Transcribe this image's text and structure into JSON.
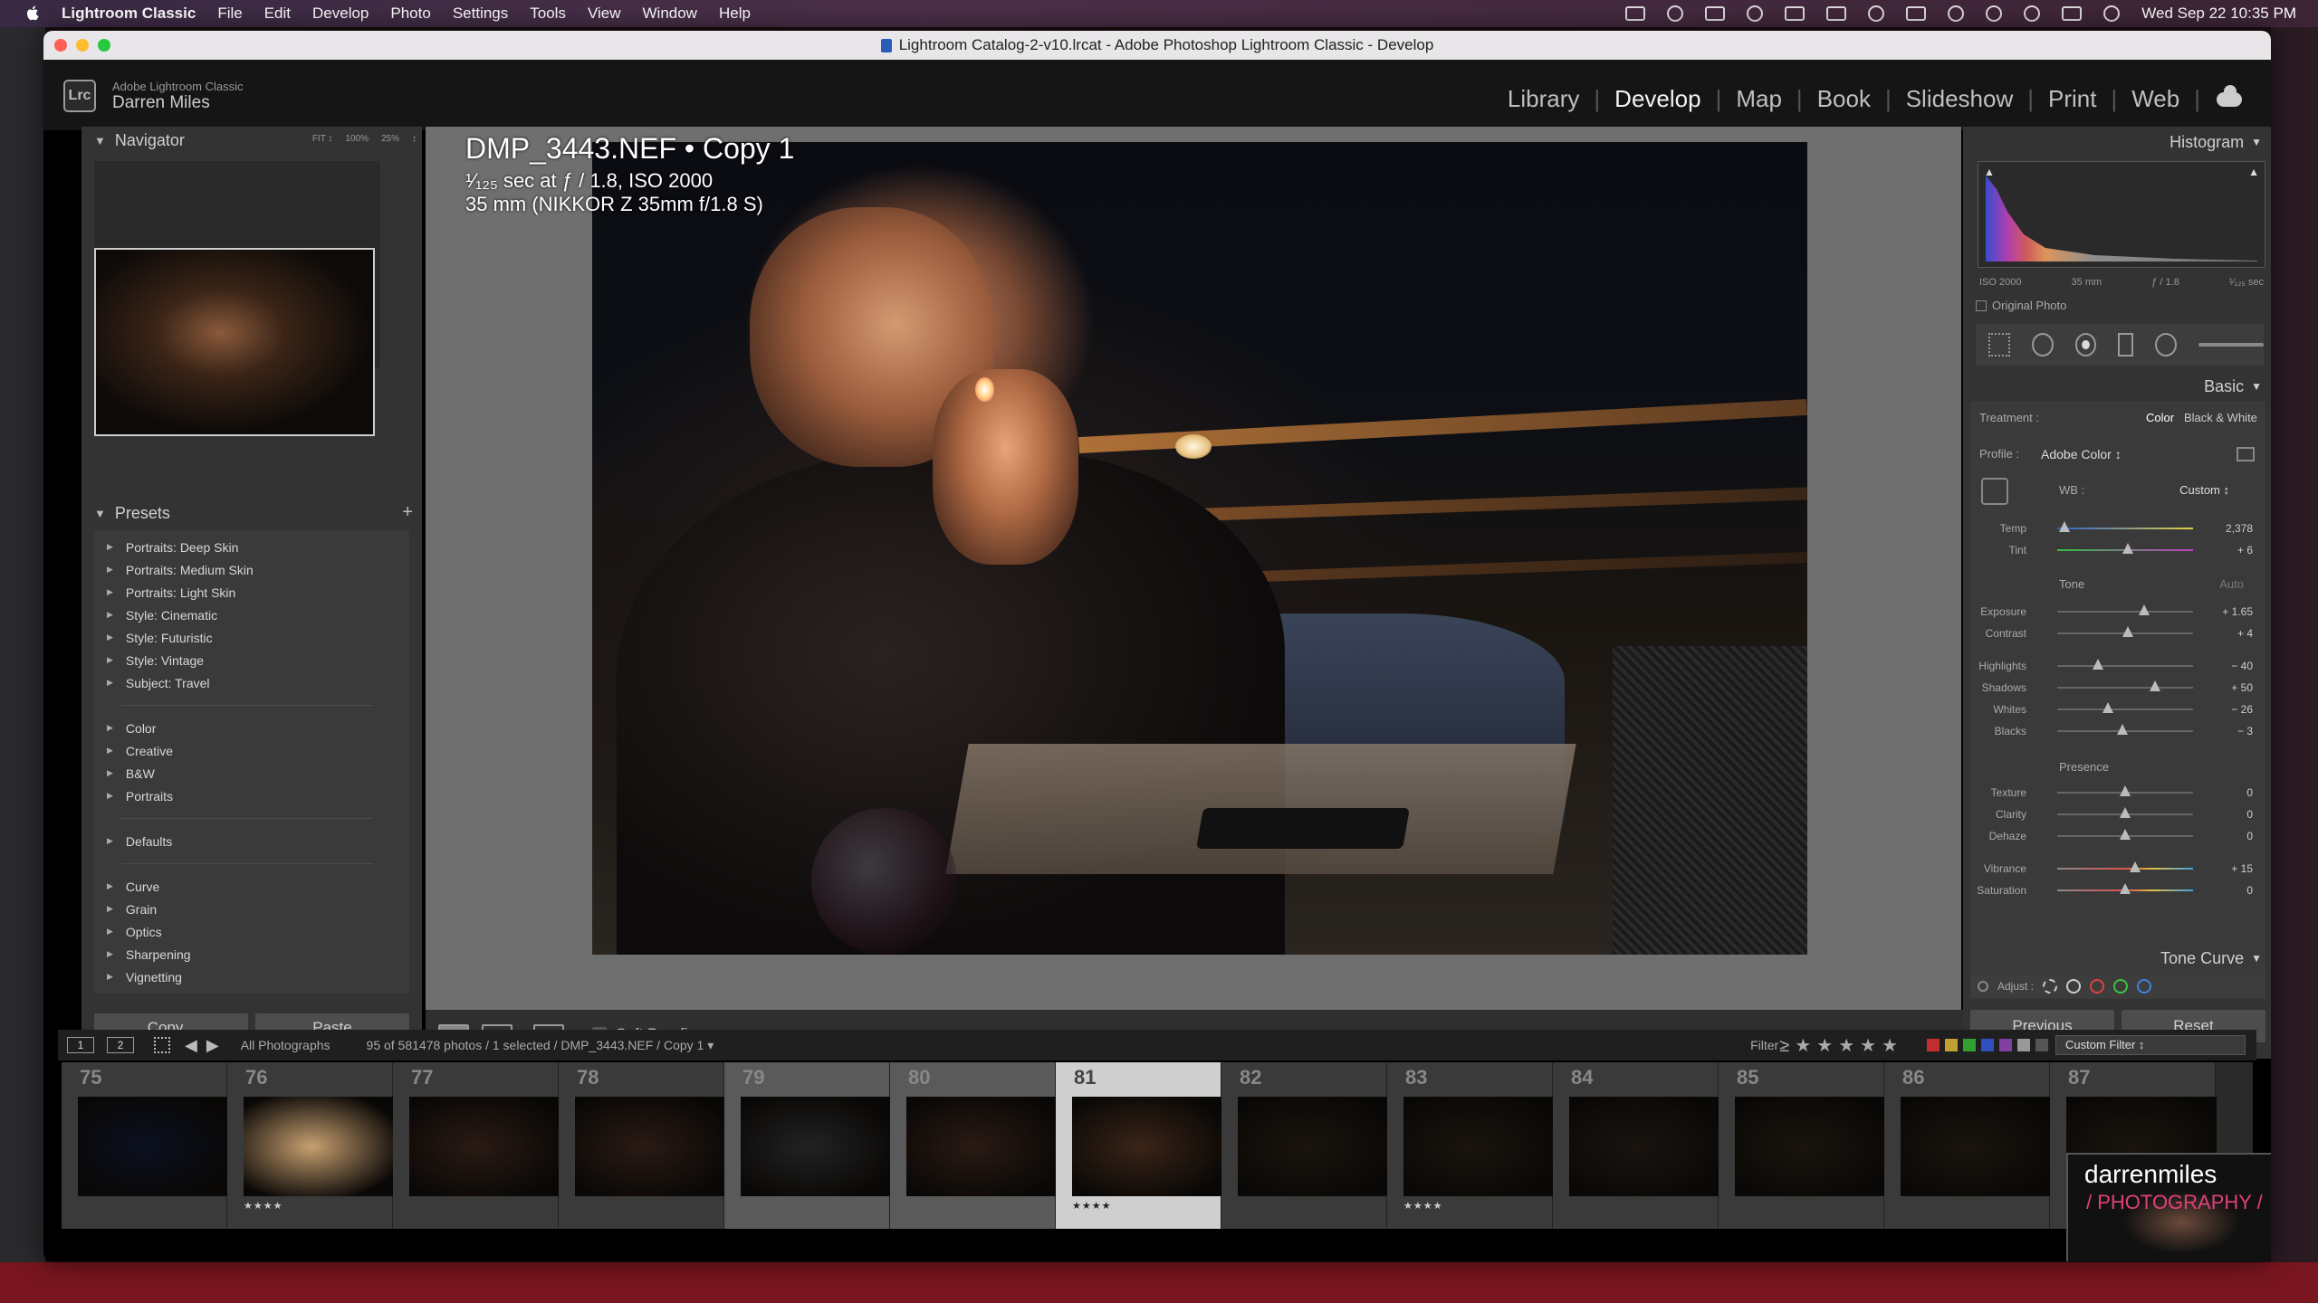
{
  "menubar": {
    "app": "Lightroom Classic",
    "items": [
      "File",
      "Edit",
      "Develop",
      "Photo",
      "Settings",
      "Tools",
      "View",
      "Window",
      "Help"
    ],
    "clock": "Wed Sep 22  10:35 PM"
  },
  "window": {
    "title": "Lightroom Catalog-2-v10.lrcat - Adobe Photoshop Lightroom Classic - Develop"
  },
  "identity": {
    "badge": "Lrc",
    "product": "Adobe Lightroom Classic",
    "user": "Darren Miles"
  },
  "modules": [
    "Library",
    "Develop",
    "Map",
    "Book",
    "Slideshow",
    "Print",
    "Web"
  ],
  "active_module": "Develop",
  "navigator": {
    "title": "Navigator",
    "zoom_options": [
      "FIT ↕",
      "100%",
      "25%",
      "↕"
    ]
  },
  "presets": {
    "title": "Presets",
    "groups": [
      [
        "Portraits: Deep Skin",
        "Portraits: Medium Skin",
        "Portraits: Light Skin",
        "Style: Cinematic",
        "Style: Futuristic",
        "Style: Vintage",
        "Subject: Travel"
      ],
      [
        "Color",
        "Creative",
        "B&W",
        "Portraits"
      ],
      [
        "Defaults"
      ],
      [
        "Curve",
        "Grain",
        "Optics",
        "Sharpening",
        "Vignetting"
      ]
    ]
  },
  "buttons": {
    "copy": "Copy...",
    "paste": "Paste",
    "previous": "Previous",
    "reset": "Reset"
  },
  "photo": {
    "filename": "DMP_3443.NEF  •  Copy 1",
    "exposure": "¹⁄₁₂₅ sec at ƒ / 1.8, ISO 2000",
    "lens": "35 mm (NIKKOR Z 35mm f/1.8 S)"
  },
  "toolbar": {
    "soft_proofing": "Soft Proofing"
  },
  "histogram": {
    "title": "Histogram",
    "iso": "ISO 2000",
    "focal": "35 mm",
    "aperture": "ƒ / 1.8",
    "shutter": "¹⁄₁₂₅ sec",
    "original_photo": "Original Photo"
  },
  "basic": {
    "title": "Basic",
    "treatment_label": "Treatment :",
    "treatment_color": "Color",
    "treatment_bw": "Black & White",
    "profile_label": "Profile :",
    "profile_value": "Adobe Color ↕",
    "wb_label": "WB :",
    "wb_value": "Custom ↕",
    "tone_label": "Tone",
    "auto_label": "Auto",
    "presence_label": "Presence",
    "sliders": {
      "temp": {
        "label": "Temp",
        "value": "2,378",
        "pos": 0.05
      },
      "tint": {
        "label": "Tint",
        "value": "+ 6",
        "pos": 0.52
      },
      "exposure": {
        "label": "Exposure",
        "value": "+ 1.65",
        "pos": 0.64
      },
      "contrast": {
        "label": "Contrast",
        "value": "+ 4",
        "pos": 0.52
      },
      "highlights": {
        "label": "Highlights",
        "value": "− 40",
        "pos": 0.3
      },
      "shadows": {
        "label": "Shadows",
        "value": "+ 50",
        "pos": 0.72
      },
      "whites": {
        "label": "Whites",
        "value": "− 26",
        "pos": 0.37
      },
      "blacks": {
        "label": "Blacks",
        "value": "− 3",
        "pos": 0.48
      },
      "texture": {
        "label": "Texture",
        "value": "0",
        "pos": 0.5
      },
      "clarity": {
        "label": "Clarity",
        "value": "0",
        "pos": 0.5
      },
      "dehaze": {
        "label": "Dehaze",
        "value": "0",
        "pos": 0.5
      },
      "vibrance": {
        "label": "Vibrance",
        "value": "+ 15",
        "pos": 0.57
      },
      "saturation": {
        "label": "Saturation",
        "value": "0",
        "pos": 0.5
      }
    }
  },
  "tone_curve": {
    "title": "Tone Curve",
    "adjust_label": "Adjust :"
  },
  "filmbar": {
    "page1": "1",
    "page2": "2",
    "source": "All Photographs",
    "count": "95 of 581478 photos / 1 selected / DMP_3443.NEF / Copy 1 ▾",
    "filter_label": "Filter :",
    "custom_filter": "Custom Filter ↕"
  },
  "filmstrip": [
    {
      "num": "75",
      "stars": "",
      "state": "normal",
      "color": "#0b1020"
    },
    {
      "num": "76",
      "stars": "★★★★",
      "state": "normal",
      "color": "#c8a070"
    },
    {
      "num": "77",
      "stars": "",
      "state": "normal",
      "color": "#2a1a14"
    },
    {
      "num": "78",
      "stars": "",
      "state": "normal",
      "color": "#2a1a14"
    },
    {
      "num": "79",
      "stars": "",
      "state": "dim",
      "color": "#222"
    },
    {
      "num": "80",
      "stars": "",
      "state": "dim",
      "color": "#2a1a14"
    },
    {
      "num": "81",
      "stars": "★★★★",
      "state": "sel",
      "color": "#3a2418"
    },
    {
      "num": "82",
      "stars": "",
      "state": "normal",
      "color": "#1a140e"
    },
    {
      "num": "83",
      "stars": "★★★★",
      "state": "normal",
      "color": "#1a140e"
    },
    {
      "num": "84",
      "stars": "",
      "state": "normal",
      "color": "#1a1410"
    },
    {
      "num": "85",
      "stars": "",
      "state": "normal",
      "color": "#1a140e"
    },
    {
      "num": "86",
      "stars": "",
      "state": "normal",
      "color": "#1a140e"
    },
    {
      "num": "87",
      "stars": "",
      "state": "normal",
      "color": "#1a140e"
    }
  ],
  "watermark": {
    "line1": "darrenmiles",
    "line2": "/ PHOTOGRAPHY /"
  }
}
